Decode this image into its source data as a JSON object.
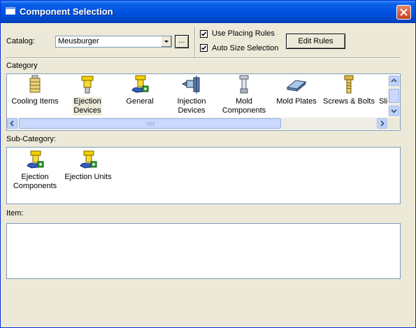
{
  "window": {
    "title": "Component Selection"
  },
  "catalog": {
    "label": "Catalog:",
    "value": "Meusburger",
    "browse_label": "..."
  },
  "options": {
    "use_placing_rules": {
      "label": "Use Placing Rules",
      "checked": true
    },
    "auto_size_selection": {
      "label": "Auto Size Selection",
      "checked": true
    },
    "edit_rules_label": "Edit Rules"
  },
  "category": {
    "label": "Category",
    "items": [
      {
        "line1": "Cooling Items",
        "line2": "",
        "icon": "cooling-items-icon",
        "selected": false
      },
      {
        "line1": "Ejection",
        "line2": "Devices",
        "icon": "ejection-devices-icon",
        "selected": true
      },
      {
        "line1": "General",
        "line2": "",
        "icon": "general-icon",
        "selected": false
      },
      {
        "line1": "Injection",
        "line2": "Devices",
        "icon": "injection-devices-icon",
        "selected": false
      },
      {
        "line1": "Mold",
        "line2": "Components",
        "icon": "mold-components-icon",
        "selected": false
      },
      {
        "line1": "Mold Plates",
        "line2": "",
        "icon": "mold-plates-icon",
        "selected": false
      },
      {
        "line1": "Screws & Bolts",
        "line2": "",
        "icon": "screws-bolts-icon",
        "selected": false
      },
      {
        "line1": "Sli",
        "line2": "",
        "icon": "slides-icon",
        "selected": false
      }
    ]
  },
  "subcategory": {
    "label": "Sub-Category:",
    "items": [
      {
        "line1": "Ejection",
        "line2": "Components",
        "icon": "ejection-components-icon"
      },
      {
        "line1": "Ejection Units",
        "line2": "",
        "icon": "ejection-units-icon"
      }
    ]
  },
  "item": {
    "label": "Item:"
  },
  "colors": {
    "title_bar": "#0054e3",
    "dialog_bg": "#ece9d8",
    "panel_border": "#7f9db9",
    "selection_bg": "#ece9d8"
  }
}
